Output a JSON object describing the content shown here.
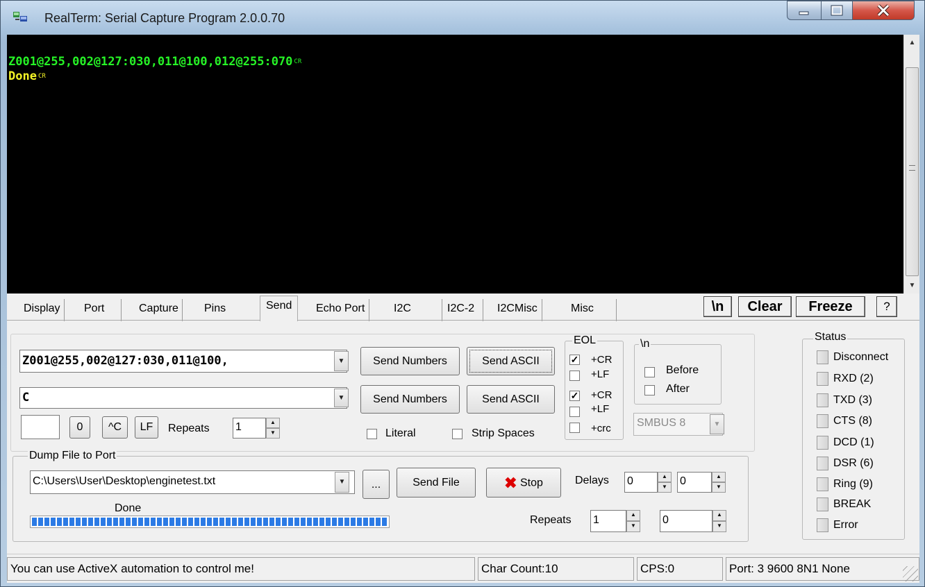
{
  "window": {
    "title": "RealTerm: Serial Capture Program 2.0.0.70",
    "controls": [
      "minimize",
      "maximize",
      "close"
    ]
  },
  "terminal": {
    "lines": [
      {
        "text": "Z001@255,002@127:030,011@100,012@255:070",
        "eol": "CR",
        "color": "#26f326"
      },
      {
        "text": "Done",
        "eol": "CR",
        "color": "#f3f326"
      }
    ]
  },
  "tabs": [
    "Display",
    "Port",
    "Capture",
    "Pins",
    "Send",
    "Echo Port",
    "I2C",
    "I2C-2",
    "I2CMisc",
    "Misc"
  ],
  "active_tab": "Send",
  "header_buttons": {
    "newline": "\\n",
    "clear": "Clear",
    "freeze": "Freeze",
    "help": "?"
  },
  "send": {
    "line1_value": "Z001@255,002@127:030,011@100,",
    "line2_value": "C",
    "send_numbers": "Send Numbers",
    "send_ascii": "Send ASCII",
    "small_box_value": "",
    "zero_btn": "0",
    "ctrl_c_btn": "^C",
    "lf_btn": "LF",
    "repeats_label": "Repeats",
    "repeats_value": "1",
    "literal_label": "Literal",
    "strip_spaces_label": "Strip Spaces",
    "eol_title": "EOL",
    "eol_options": [
      {
        "label": "+CR",
        "checked": true
      },
      {
        "label": "+LF",
        "checked": false
      },
      {
        "label": "+CR",
        "checked": true
      },
      {
        "label": "+LF",
        "checked": false
      },
      {
        "label": "+crc",
        "checked": false
      }
    ],
    "newline_group": {
      "title": "\\n",
      "before": "Before",
      "after": "After"
    },
    "smbus_value": "SMBUS 8"
  },
  "dump": {
    "title": "Dump File to Port",
    "file_path": "C:\\Users\\User\\Desktop\\enginetest.txt",
    "browse_btn": "...",
    "send_file_btn": "Send File",
    "stop_btn": "Stop",
    "delays_label": "Delays",
    "delay1": "0",
    "delay2": "0",
    "repeats_label": "Repeats",
    "repeats1": "1",
    "repeats2": "0",
    "status_text": "Done",
    "progress": 1.0
  },
  "status": {
    "title": "Status",
    "items": [
      "Disconnect",
      "RXD (2)",
      "TXD (3)",
      "CTS (8)",
      "DCD (1)",
      "DSR (6)",
      "Ring (9)",
      "BREAK",
      "Error"
    ]
  },
  "statusbar": {
    "message": "You can use ActiveX automation to control me!",
    "char_count": "Char Count:10",
    "cps": "CPS:0",
    "port": "Port: 3 9600 8N1 None"
  }
}
